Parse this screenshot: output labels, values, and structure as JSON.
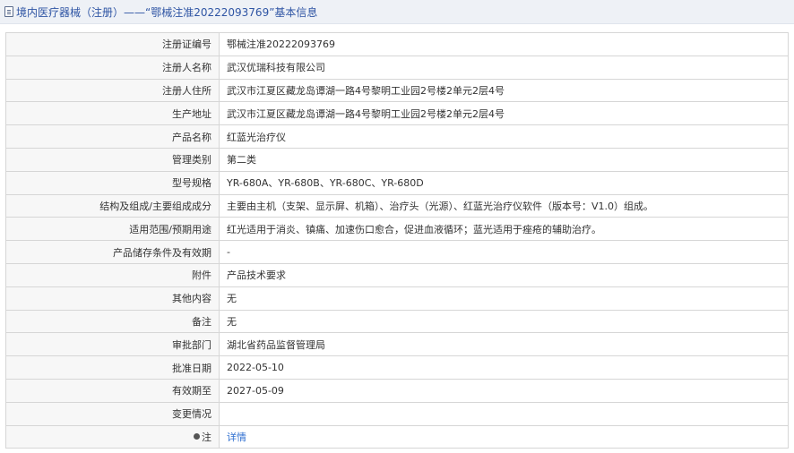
{
  "header": {
    "title": "境内医疗器械（注册）——“鄂械注准20222093769”基本信息"
  },
  "rows": [
    {
      "label": "注册证编号",
      "value": "鄂械注准20222093769"
    },
    {
      "label": "注册人名称",
      "value": "武汉优瑞科技有限公司"
    },
    {
      "label": "注册人住所",
      "value": "武汉市江夏区藏龙岛谭湖一路4号黎明工业园2号楼2单元2层4号"
    },
    {
      "label": "生产地址",
      "value": "武汉市江夏区藏龙岛谭湖一路4号黎明工业园2号楼2单元2层4号"
    },
    {
      "label": "产品名称",
      "value": "红蓝光治疗仪"
    },
    {
      "label": "管理类别",
      "value": "第二类"
    },
    {
      "label": "型号规格",
      "value": "YR-680A、YR-680B、YR-680C、YR-680D"
    },
    {
      "label": "结构及组成/主要组成成分",
      "value": "主要由主机（支架、显示屏、机箱）、治疗头（光源）、红蓝光治疗仪软件（版本号：V1.0）组成。"
    },
    {
      "label": "适用范围/预期用途",
      "value": "红光适用于消炎、镇痛、加速伤口愈合，促进血液循环；蓝光适用于痤疮的辅助治疗。"
    },
    {
      "label": "产品储存条件及有效期",
      "value": "-"
    },
    {
      "label": "附件",
      "value": "产品技术要求"
    },
    {
      "label": "其他内容",
      "value": "无"
    },
    {
      "label": "备注",
      "value": "无"
    },
    {
      "label": "审批部门",
      "value": "湖北省药品监督管理局"
    },
    {
      "label": "批准日期",
      "value": "2022-05-10"
    },
    {
      "label": "有效期至",
      "value": "2027-05-09"
    },
    {
      "label": "变更情况",
      "value": ""
    }
  ],
  "note_row": {
    "label": "注",
    "link_text": "详情",
    "icon": "pin-icon"
  }
}
